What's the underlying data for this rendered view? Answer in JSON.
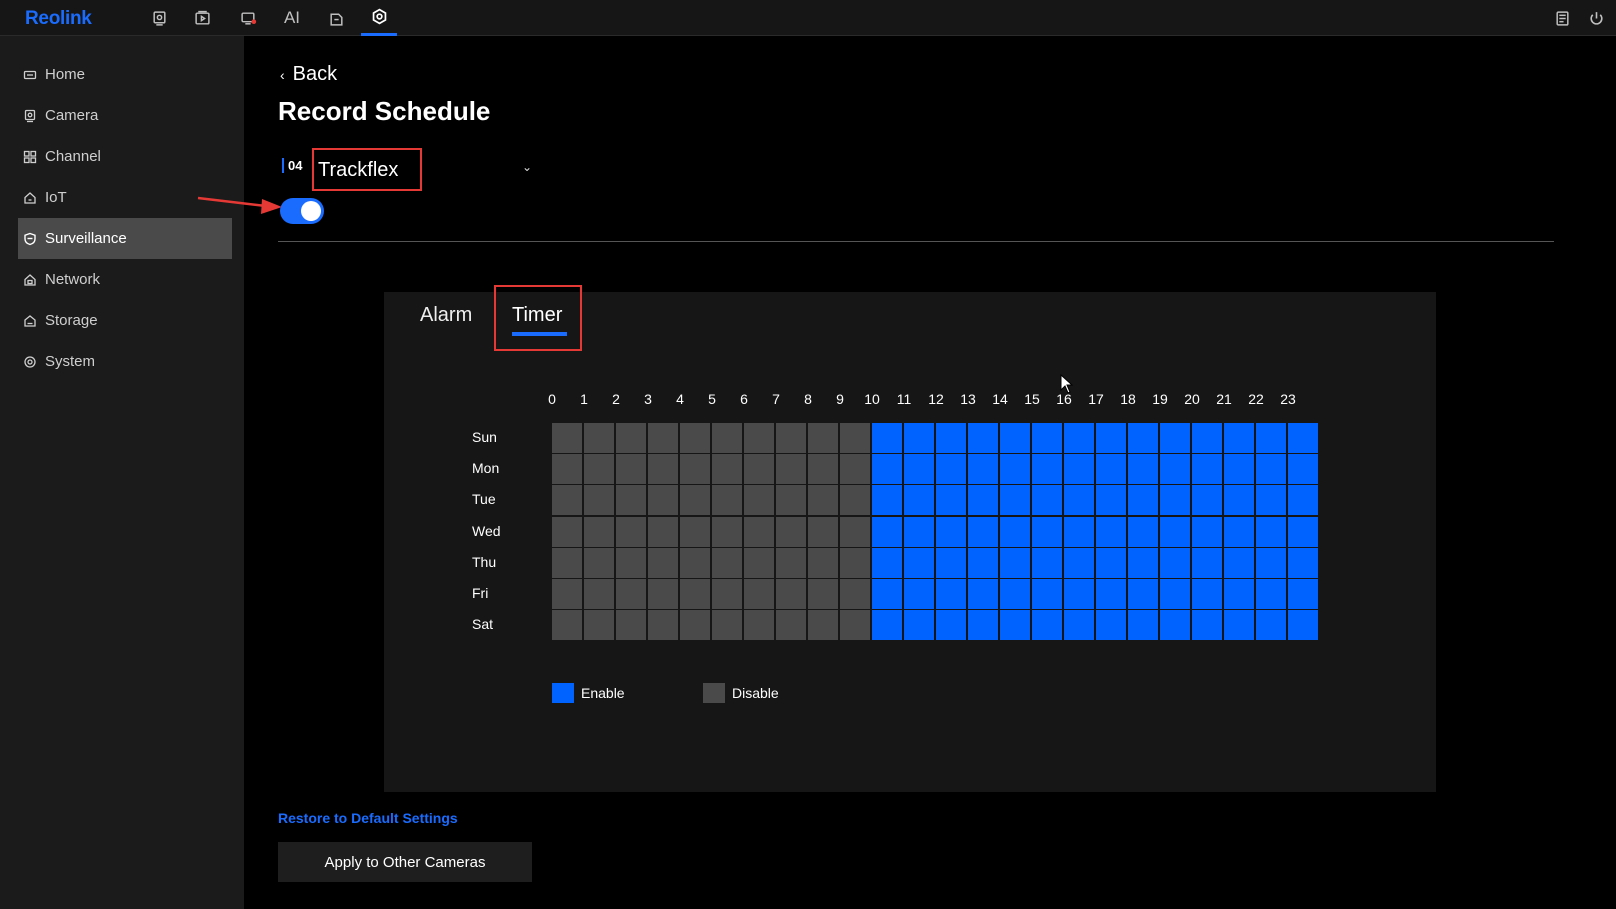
{
  "app": {
    "brand": "Reolink",
    "accent": "#1a6cff"
  },
  "topbar": {
    "icons": [
      "live-view-icon",
      "playback-icon",
      "alerts-icon",
      "ai-icon",
      "file-icon",
      "settings-icon"
    ],
    "ai_label": "AI",
    "right_icons": [
      "notes-icon",
      "power-icon"
    ]
  },
  "sidebar": {
    "items": [
      {
        "label": "Home",
        "icon": "home-icon"
      },
      {
        "label": "Camera",
        "icon": "camera-icon"
      },
      {
        "label": "Channel",
        "icon": "channel-icon"
      },
      {
        "label": "IoT",
        "icon": "iot-icon"
      },
      {
        "label": "Surveillance",
        "icon": "shield-icon",
        "active": true
      },
      {
        "label": "Network",
        "icon": "network-icon"
      },
      {
        "label": "Storage",
        "icon": "storage-icon"
      },
      {
        "label": "System",
        "icon": "system-icon"
      }
    ]
  },
  "main": {
    "back_label": "Back",
    "title": "Record Schedule",
    "channel_number": "04",
    "channel_name": "Trackflex",
    "record_enabled": true,
    "tabs": [
      {
        "label": "Alarm"
      },
      {
        "label": "Timer",
        "active": true
      }
    ],
    "restore_label": "Restore to Default Settings",
    "apply_label": "Apply to Other Cameras"
  },
  "schedule": {
    "hours": [
      "0",
      "1",
      "2",
      "3",
      "4",
      "5",
      "6",
      "7",
      "8",
      "9",
      "10",
      "11",
      "12",
      "13",
      "14",
      "15",
      "16",
      "17",
      "18",
      "19",
      "20",
      "21",
      "22",
      "23"
    ],
    "days": [
      "Sun",
      "Mon",
      "Tue",
      "Wed",
      "Thu",
      "Fri",
      "Sat"
    ],
    "enabled_from_hour": 10,
    "enabled_to_hour": 23,
    "enable_color": "#0062ff",
    "disable_color": "#4a4a4a"
  },
  "legend": {
    "enable_label": "Enable",
    "disable_label": "Disable"
  }
}
